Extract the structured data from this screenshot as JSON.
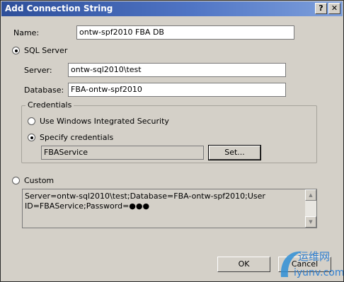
{
  "window": {
    "title": "Add Connection String",
    "help_glyph": "?",
    "close_glyph": "✕"
  },
  "name": {
    "label": "Name:",
    "value": "ontw-spf2010 FBA DB"
  },
  "sql_server": {
    "label": "SQL Server",
    "selected": true,
    "server": {
      "label": "Server:",
      "value": "ontw-sql2010\\test"
    },
    "database": {
      "label": "Database:",
      "value": "FBA-ontw-spf2010"
    }
  },
  "credentials": {
    "legend": "Credentials",
    "windows_integrated": {
      "label": "Use Windows Integrated Security",
      "selected": false
    },
    "specify": {
      "label": "Specify credentials",
      "selected": true
    },
    "username": "FBAService",
    "set_button": "Set..."
  },
  "custom": {
    "label": "Custom",
    "selected": false,
    "connection_string": "Server=ontw-sql2010\\test;Database=FBA-ontw-spf2010;User ID=FBAService;Password=●●●"
  },
  "buttons": {
    "ok": "OK",
    "cancel": "Cancel"
  },
  "watermark": {
    "brand_cn": "运维网",
    "domain": "iyunv.com"
  },
  "colors": {
    "titlebar": "#2e4f9a",
    "dialog": "#d4d0c8"
  }
}
